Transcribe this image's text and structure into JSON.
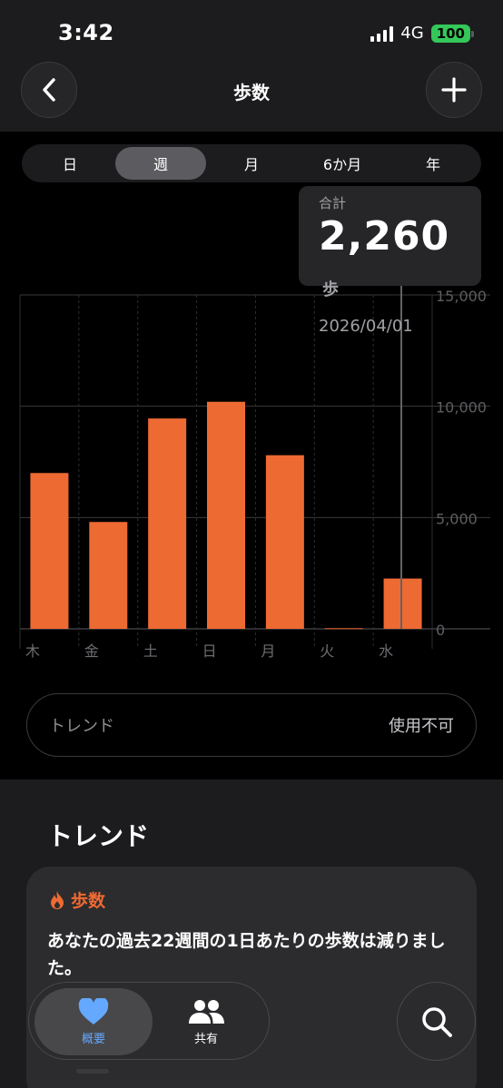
{
  "status": {
    "time": "3:42",
    "network": "4G",
    "battery": "100"
  },
  "nav": {
    "title": "歩数",
    "back_icon": "chevron-left-icon",
    "add_icon": "plus-icon"
  },
  "segments": [
    {
      "label": "日",
      "active": false
    },
    {
      "label": "週",
      "active": true
    },
    {
      "label": "月",
      "active": false
    },
    {
      "label": "6か月",
      "active": false
    },
    {
      "label": "年",
      "active": false
    }
  ],
  "tooltip": {
    "label": "合計",
    "value": "2,260",
    "unit": "歩",
    "date": "2026/04/01"
  },
  "chart_data": {
    "type": "bar",
    "categories": [
      "木",
      "金",
      "土",
      "日",
      "月",
      "火",
      "水"
    ],
    "values": [
      7000,
      4800,
      9450,
      10200,
      7800,
      30,
      2260
    ],
    "ylim": [
      0,
      15000
    ],
    "yticks": [
      "15,000",
      "10,000",
      "5,000",
      "0"
    ],
    "ytick_values": [
      15000,
      10000,
      5000,
      0
    ],
    "bar_color": "#ee6a33",
    "selected_index": 6
  },
  "trend_pill": {
    "label": "トレンド",
    "value": "使用不可"
  },
  "trends": {
    "title": "トレンド",
    "card_title": "歩数",
    "card_icon": "flame-icon",
    "card_text": "あなたの過去22週間の1日あたりの歩数は減りました。"
  },
  "tabbar": {
    "summary_label": "概要",
    "share_label": "共有",
    "summary_icon": "heart-icon",
    "share_icon": "people-icon",
    "search_icon": "search-icon"
  },
  "colors": {
    "accent": "#ee6a33",
    "tab_active": "#64a8ff"
  }
}
